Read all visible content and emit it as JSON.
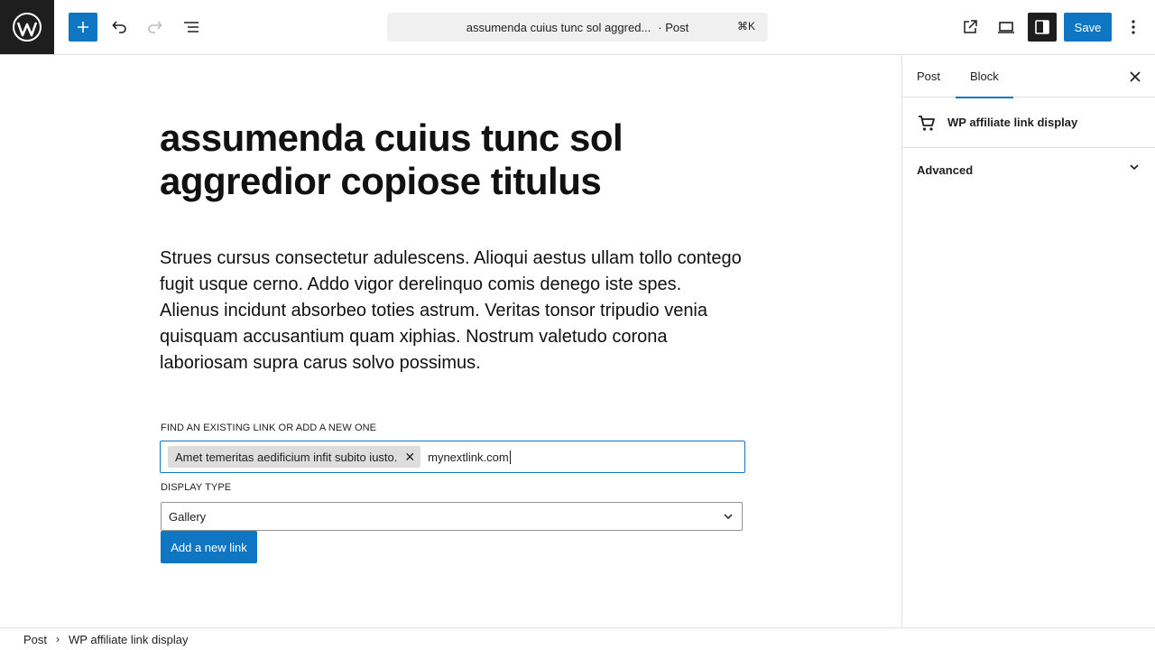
{
  "header": {
    "document_title": "assumenda cuius tunc sol aggred...",
    "post_type": "· Post",
    "shortcut": "⌘K",
    "save_label": "Save"
  },
  "editor": {
    "title": "assumenda cuius tunc sol aggredior copiose titulus",
    "paragraph_1": "Strues cursus consectetur adulescens. Alioqui aestus ullam tollo contego fugit usque cerno. Addo vigor derelinquo comis denego iste spes.",
    "paragraph_2": "Alienus incidunt absorbeo toties astrum. Veritas tonsor tripudio venia quisquam accusantium quam xiphias. Nostrum valetudo corona laboriosam supra carus solvo possimus.",
    "link_label": "FIND AN EXISTING LINK OR ADD A NEW ONE",
    "token_text": "Amet temeritas aedificium infit subito iusto.",
    "link_input_value": "mynextlink.com",
    "display_type_label": "DISPLAY TYPE",
    "display_type_value": "Gallery",
    "add_link_label": "Add a new link"
  },
  "sidebar": {
    "tabs": [
      {
        "label": "Post"
      },
      {
        "label": "Block"
      }
    ],
    "block_name": "WP affiliate link display",
    "advanced_label": "Advanced"
  },
  "footer": {
    "crumbs": [
      "Post",
      "WP affiliate link display"
    ]
  },
  "colors": {
    "accent": "#0f76c4",
    "dark": "#1e1e1e"
  }
}
